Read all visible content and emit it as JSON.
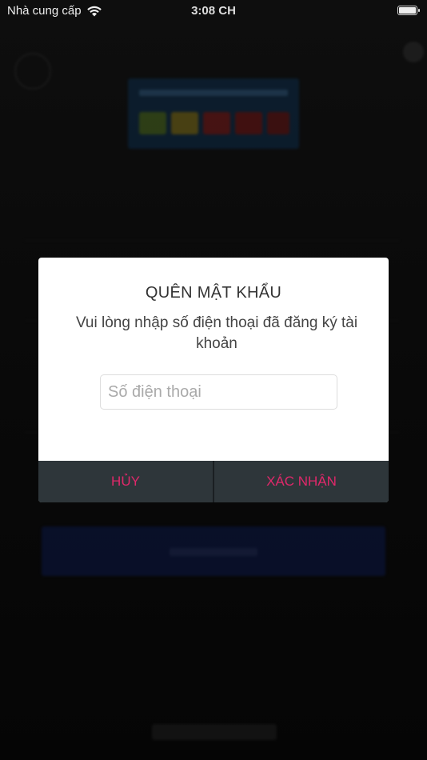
{
  "status_bar": {
    "carrier": "Nhà cung cấp",
    "time": "3:08 CH"
  },
  "dialog": {
    "title": "QUÊN MẬT KHẨU",
    "message": "Vui lòng nhập số điện thoại đã đăng ký tài khoản",
    "phone_value": "",
    "phone_placeholder": "Số điện thoại",
    "cancel_label": "HỦY",
    "confirm_label": "XÁC NHẬN"
  },
  "colors": {
    "accent": "#e0286a",
    "button_bg": "#2e363a",
    "overlay": "#000000"
  },
  "icons": [
    "wifi-icon",
    "battery-icon"
  ]
}
